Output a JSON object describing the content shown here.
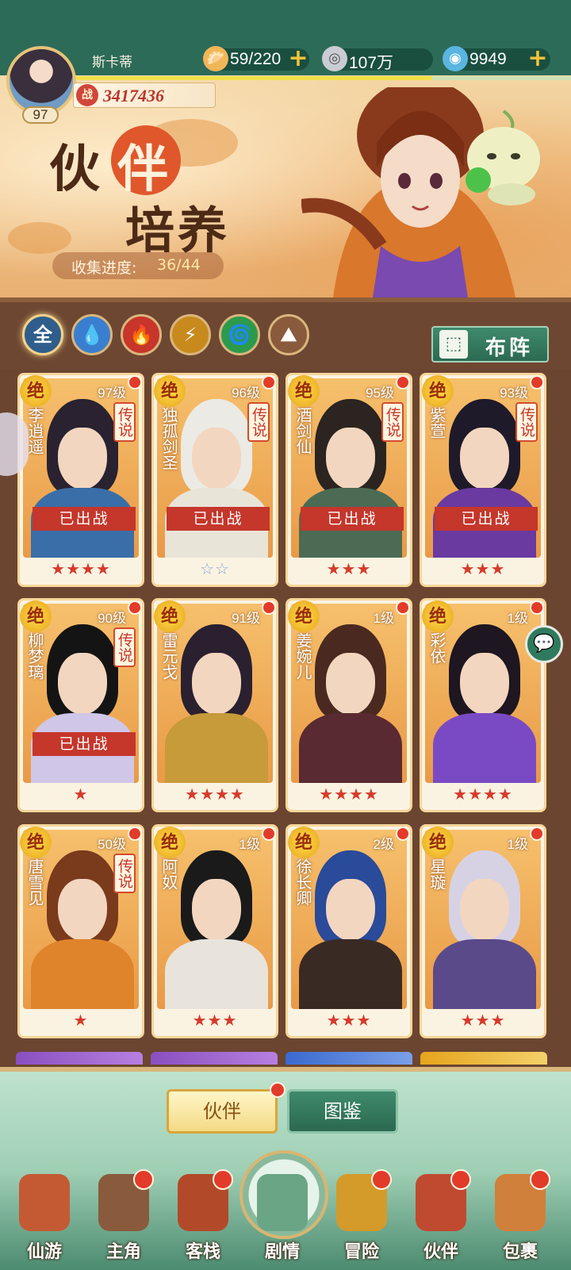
{
  "player": {
    "name": "斯卡蒂",
    "level": "97",
    "power_icon": "战",
    "power": "3417436"
  },
  "resources": [
    {
      "icon": "bun-icon",
      "value": "59/220",
      "has_plus": true
    },
    {
      "icon": "coin-icon",
      "value": "107万",
      "has_plus": false
    },
    {
      "icon": "jade-icon",
      "value": "9949",
      "has_plus": true
    }
  ],
  "exp_progress": 0.72,
  "banner": {
    "title_char1": "伙",
    "title_char2": "伴",
    "title_line2": "培养",
    "collect_label": "收集进度:",
    "collect_value": "36/44"
  },
  "filters": [
    {
      "label": "全",
      "color": "#2f5e8c",
      "selected": true
    },
    {
      "label": "💧",
      "color": "#3a7fcf"
    },
    {
      "label": "🔥",
      "color": "#c7352b"
    },
    {
      "label": "⚡",
      "color": "#c88a1c"
    },
    {
      "label": "🌀",
      "color": "#2c9a4c"
    },
    {
      "label": "⛰",
      "color": "#8a5a3c"
    }
  ],
  "formation": {
    "label": "布阵"
  },
  "rarity_mark": "绝",
  "legend_mark": "传说",
  "deployed_label": "已出战",
  "cards": [
    {
      "name": "李逍遥",
      "level": "97级",
      "legend": true,
      "deployed": true,
      "stars": "★★★★",
      "silver": false,
      "hair": "#2a2230",
      "robe": "#3a6ea8"
    },
    {
      "name": "独孤剑圣",
      "level": "96级",
      "legend": true,
      "deployed": true,
      "stars": "☆☆",
      "silver": true,
      "hair": "#eceae4",
      "robe": "#e8e4d8"
    },
    {
      "name": "酒剑仙",
      "level": "95级",
      "legend": true,
      "deployed": true,
      "stars": "★★★",
      "silver": false,
      "hair": "#2b2420",
      "robe": "#4b6b55"
    },
    {
      "name": "紫萱",
      "level": "93级",
      "legend": true,
      "deployed": true,
      "stars": "★★★",
      "silver": false,
      "hair": "#1f1a2a",
      "robe": "#6a3aa0"
    },
    {
      "name": "柳梦璃",
      "level": "90级",
      "legend": true,
      "deployed": true,
      "stars": "★",
      "silver": false,
      "hair": "#141414",
      "robe": "#cfc6e8"
    },
    {
      "name": "雷元戈",
      "level": "91级",
      "legend": false,
      "deployed": false,
      "stars": "★★★★",
      "silver": false,
      "hair": "#2a2030",
      "robe": "#c79a3a"
    },
    {
      "name": "姜婉儿",
      "level": "1级",
      "legend": false,
      "deployed": false,
      "stars": "★★★★",
      "silver": false,
      "hair": "#4a2a20",
      "robe": "#5a2a32"
    },
    {
      "name": "彩依",
      "level": "1级",
      "legend": false,
      "deployed": false,
      "stars": "★★★★",
      "silver": false,
      "hair": "#1e1620",
      "robe": "#7a4ac4"
    },
    {
      "name": "唐雪见",
      "level": "50级",
      "legend": true,
      "deployed": false,
      "stars": "★",
      "silver": false,
      "hair": "#7a3a1c",
      "robe": "#e0842c"
    },
    {
      "name": "阿奴",
      "level": "1级",
      "legend": false,
      "deployed": false,
      "stars": "★★★",
      "silver": false,
      "hair": "#1a1a1a",
      "robe": "#e8e4dc"
    },
    {
      "name": "徐长卿",
      "level": "2级",
      "legend": false,
      "deployed": false,
      "stars": "★★★",
      "silver": false,
      "hair": "#2a4a9a",
      "robe": "#3a2a24"
    },
    {
      "name": "星璇",
      "level": "1级",
      "legend": false,
      "deployed": false,
      "stars": "★★★",
      "silver": false,
      "hair": "#d6d2e4",
      "robe": "#5a4a8a"
    }
  ],
  "tabs": {
    "partner": "伙伴",
    "codex": "图鉴"
  },
  "nav": [
    {
      "label": "仙游",
      "icon": "scroll-icon",
      "color": "#c45a34",
      "dot": false
    },
    {
      "label": "主角",
      "icon": "hero-icon",
      "color": "#8a5a3c",
      "dot": true
    },
    {
      "label": "客栈",
      "icon": "inn-icon",
      "color": "#b24a2a",
      "dot": true
    },
    {
      "label": "剧情",
      "icon": "story-icon",
      "color": "#6aa585",
      "dot": false
    },
    {
      "label": "冒险",
      "icon": "gourd-icon",
      "color": "#d49a2a",
      "dot": true
    },
    {
      "label": "伙伴",
      "icon": "cards-icon",
      "color": "#c04a30",
      "dot": true
    },
    {
      "label": "包裹",
      "icon": "bag-icon",
      "color": "#d0803a",
      "dot": true
    }
  ]
}
